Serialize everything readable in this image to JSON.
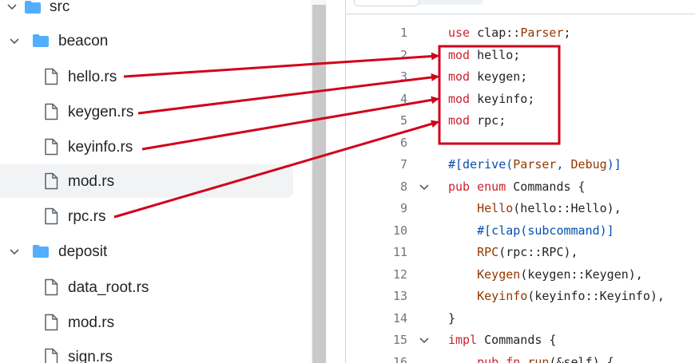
{
  "tree": {
    "items": [
      {
        "label": "src",
        "kind": "folder"
      },
      {
        "label": "beacon",
        "kind": "folder"
      },
      {
        "label": "hello.rs",
        "kind": "file"
      },
      {
        "label": "keygen.rs",
        "kind": "file"
      },
      {
        "label": "keyinfo.rs",
        "kind": "file"
      },
      {
        "label": "mod.rs",
        "kind": "file",
        "selected": true
      },
      {
        "label": "rpc.rs",
        "kind": "file"
      },
      {
        "label": "deposit",
        "kind": "folder"
      },
      {
        "label": "data_root.rs",
        "kind": "file"
      },
      {
        "label": "mod.rs",
        "kind": "file"
      },
      {
        "label": "sign.rs",
        "kind": "file"
      }
    ]
  },
  "code": {
    "line_numbers": [
      "1",
      "2",
      "3",
      "4",
      "5",
      "6",
      "7",
      "8",
      "9",
      "10",
      "11",
      "12",
      "13",
      "14",
      "15",
      "16"
    ],
    "lines": [
      [
        {
          "t": "use",
          "c": "kw"
        },
        {
          "t": " clap::"
        },
        {
          "t": "Parser",
          "c": "ty"
        },
        {
          "t": ";"
        }
      ],
      [
        {
          "t": "mod",
          "c": "kw"
        },
        {
          "t": " hello;"
        }
      ],
      [
        {
          "t": "mod",
          "c": "kw"
        },
        {
          "t": " keygen;"
        }
      ],
      [
        {
          "t": "mod",
          "c": "kw"
        },
        {
          "t": " keyinfo;"
        }
      ],
      [
        {
          "t": "mod",
          "c": "kw"
        },
        {
          "t": " rpc;"
        }
      ],
      [],
      [
        {
          "t": "#[derive(",
          "c": "at"
        },
        {
          "t": "Parser",
          "c": "ty"
        },
        {
          "t": ", ",
          "c": "at"
        },
        {
          "t": "Debug",
          "c": "ty"
        },
        {
          "t": ")]",
          "c": "at"
        }
      ],
      [
        {
          "t": "pub",
          "c": "kw"
        },
        {
          "t": " "
        },
        {
          "t": "enum",
          "c": "kw"
        },
        {
          "t": " Commands {"
        }
      ],
      [
        {
          "t": "    "
        },
        {
          "t": "Hello",
          "c": "ty"
        },
        {
          "t": "(hello::Hello),"
        }
      ],
      [
        {
          "t": "    "
        },
        {
          "t": "#[clap(subcommand)]",
          "c": "at"
        }
      ],
      [
        {
          "t": "    "
        },
        {
          "t": "RPC",
          "c": "ty"
        },
        {
          "t": "(rpc::RPC),"
        }
      ],
      [
        {
          "t": "    "
        },
        {
          "t": "Keygen",
          "c": "ty"
        },
        {
          "t": "(keygen::Keygen),"
        }
      ],
      [
        {
          "t": "    "
        },
        {
          "t": "Keyinfo",
          "c": "ty"
        },
        {
          "t": "(keyinfo::Keyinfo),"
        }
      ],
      [
        {
          "t": "}"
        }
      ],
      [
        {
          "t": "impl",
          "c": "kw"
        },
        {
          "t": " Commands {"
        }
      ],
      [
        {
          "t": "    "
        },
        {
          "t": "pub",
          "c": "kw"
        },
        {
          "t": " "
        },
        {
          "t": "fn",
          "c": "kw"
        },
        {
          "t": " "
        },
        {
          "t": "run",
          "c": "ty"
        },
        {
          "t": "(&self) {"
        }
      ]
    ],
    "foldable": [
      "8",
      "15"
    ]
  },
  "colors": {
    "annotation": "#d0021b",
    "keyword": "#cf222e",
    "type": "#953800",
    "attribute": "#0550ae",
    "folder": "#54aeff"
  }
}
